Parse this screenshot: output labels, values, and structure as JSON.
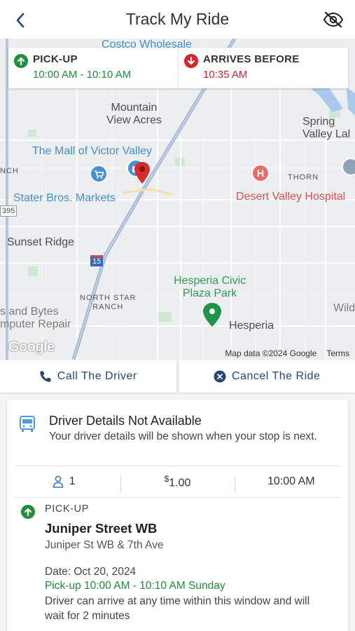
{
  "header": {
    "title": "Track My Ride",
    "back_icon": "chevron-left-icon",
    "visibility_icon": "eye-off-icon"
  },
  "map": {
    "labels": {
      "costco": "Costco Wholesale",
      "mountain_view": "Mountain\nView Acres",
      "spring_valley": "Spring\nValley Lal",
      "mall": "The Mall of Victor Valley",
      "nch": "NCH",
      "stater": "Stater Bros. Markets",
      "desert_valley": "Desert Valley Hospital",
      "thorn": "THORN",
      "hwy395": "395",
      "sunset": "Sunset Ridge",
      "i15": "15",
      "north_star": "NORTH STAR\nRANCH",
      "hesperia_civic": "Hesperia Civic\nPlaza Park",
      "bytes": "s and Bytes\nmputer Repair",
      "hesperia": "Hesperia",
      "wild": "Wild",
      "google": "Google",
      "map_data": "Map data ©2024 Google",
      "terms": "Terms"
    }
  },
  "info_card": {
    "pickup_label": "PICK-UP",
    "pickup_time": "10:00 AM - 10:10 AM",
    "arrives_label": "ARRIVES BEFORE",
    "arrives_time": "10:35 AM"
  },
  "actions": {
    "call_label": "Call The Driver",
    "cancel_label": "Cancel The Ride"
  },
  "driver": {
    "title": "Driver Details Not Available",
    "subtitle": "Your driver details will be shown when your stop is next."
  },
  "stats": {
    "passengers": "1",
    "fare_symbol": "$",
    "fare": "1.00",
    "time": "10:00 AM"
  },
  "pickup": {
    "label": "PICK-UP",
    "stop_name": "Juniper Street WB",
    "stop_address": "Juniper St WB & 7th Ave",
    "date": "Date: Oct 20, 2024",
    "window": "Pick-up 10:00 AM - 10:10 AM Sunday",
    "note": "Driver can arrive at any time within this window and will wait for 2 minutes"
  },
  "colors": {
    "green": "#1e8f3a",
    "red": "#d9222a",
    "navy": "#23477a",
    "map_blue": "#3f8fd4"
  }
}
